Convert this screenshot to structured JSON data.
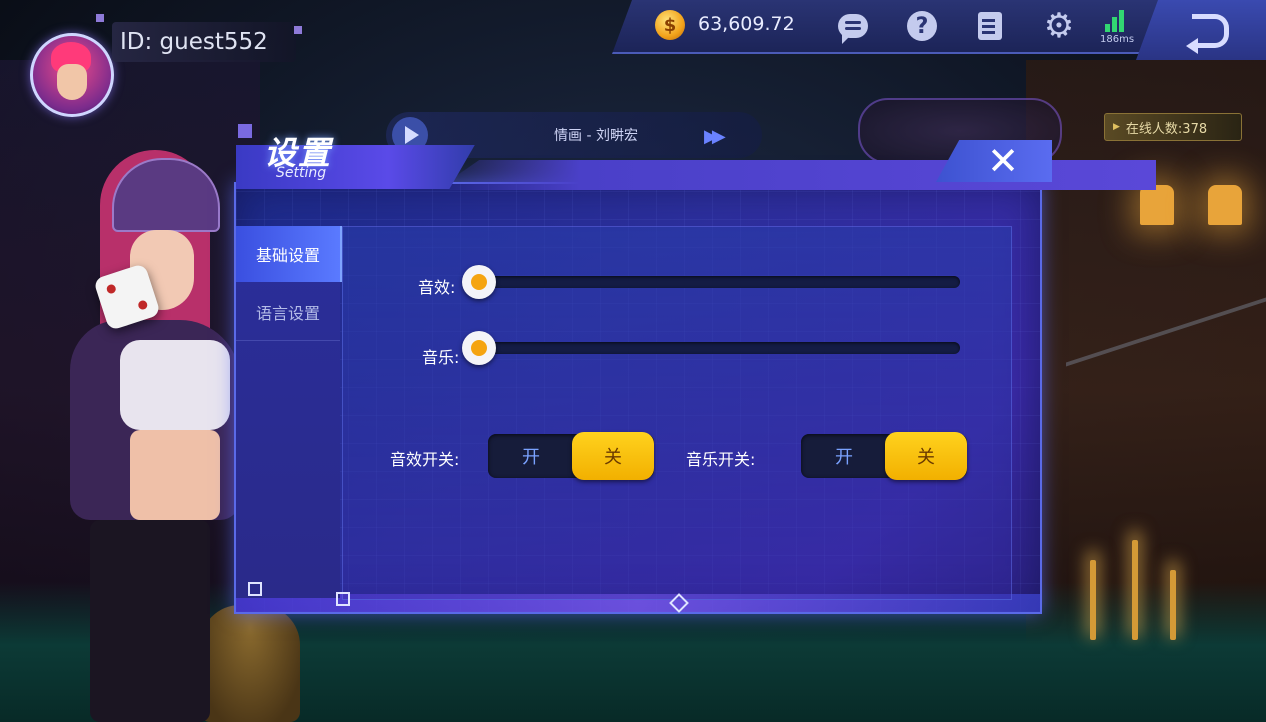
{
  "user": {
    "id_label": "ID: guest552"
  },
  "topbar": {
    "coin_symbol": "$",
    "coins": "63,609.72",
    "latency": "186ms",
    "icons": [
      "chat-icon",
      "help-icon",
      "notes-icon",
      "gear-icon",
      "signal-icon",
      "back-icon"
    ]
  },
  "player": {
    "song": "情画 - 刘畊宏"
  },
  "online": {
    "label": "在线人数:378"
  },
  "dialog": {
    "title": "设置",
    "subtitle": "Setting",
    "close_label": "✕",
    "menu": [
      {
        "label": "基础设置",
        "active": true
      },
      {
        "label": "语言设置",
        "active": false
      }
    ],
    "sliders": [
      {
        "label": "音效:",
        "level": 0
      },
      {
        "label": "音乐:",
        "level": 0
      }
    ],
    "toggles": [
      {
        "label": "音效开关:",
        "on_label": "开",
        "off_label": "关",
        "selected": "关"
      },
      {
        "label": "音乐开关:",
        "on_label": "开",
        "off_label": "关",
        "selected": "关"
      }
    ]
  },
  "colors": {
    "accent": "#5a6ae8",
    "toggle_selected": "#ffd21e",
    "knob_dot": "#f5a410",
    "signal": "#32d672"
  }
}
